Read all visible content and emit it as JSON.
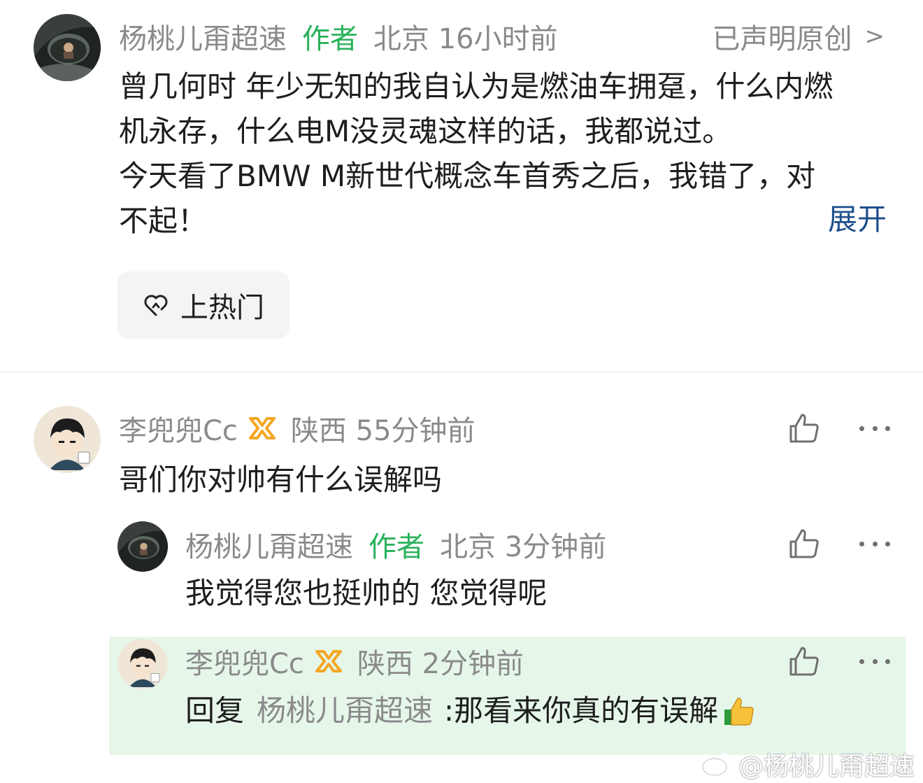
{
  "post": {
    "username": "杨桃儿甭超速",
    "author_tag": "作者",
    "location_time": "北京 16小时前",
    "original_label": "已声明原创",
    "original_chevron": ">",
    "body_lines": [
      "曾几何时 年少无知的我自认为是燃油车拥趸，什么内燃",
      "机永存，什么电M没灵魂这样的话，我都说过。",
      "今天看了BMW M新世代概念车首秀之后，我错了，对",
      "不起！"
    ],
    "expand_label": "展开",
    "hot_button_label": "上热门",
    "hot_icon": "heart-arrow-icon"
  },
  "comments": [
    {
      "username": "李兜兜Cc",
      "badge_icon": "vip-badge-icon",
      "location_time": "陕西 55分钟前",
      "text": "哥们你对帅有什么误解吗"
    },
    {
      "username": "杨桃儿甭超速",
      "author_tag": "作者",
      "location_time": "北京 3分钟前",
      "text": "我觉得您也挺帅的 您觉得呢"
    },
    {
      "username": "李兜兜Cc",
      "badge_icon": "vip-badge-icon",
      "location_time": "陕西 2分钟前",
      "reply_prefix": "回复",
      "reply_to": "杨桃儿甭超速",
      "text": ":那看来你真的有误解",
      "emoji": "thumbs-up-emoji"
    }
  ],
  "watermark": {
    "text": "@杨桃儿甭超速",
    "icon": "weibo-icon"
  },
  "colors": {
    "author_green": "#29b25b",
    "link_blue": "#1d4f8c",
    "meta_gray": "#8a8a8a",
    "highlight_bg": "#e6f7ea",
    "badge_orange": "#f5a623"
  }
}
